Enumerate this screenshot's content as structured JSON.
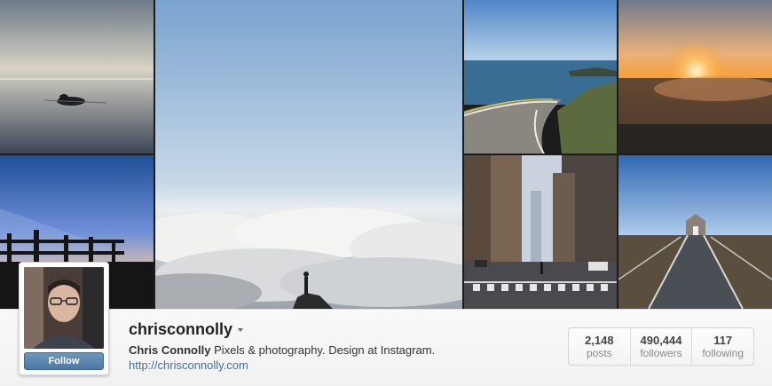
{
  "profile": {
    "username": "chrisconnolly",
    "full_name": "Chris Connolly",
    "bio": "Pixels & photography. Design at Instagram.",
    "website": "http://chrisconnolly.com",
    "follow_label": "Follow"
  },
  "stats": [
    {
      "value": "2,148",
      "label": "posts"
    },
    {
      "value": "490,444",
      "label": "followers"
    },
    {
      "value": "117",
      "label": "following"
    }
  ],
  "photos": [
    {
      "subject": "calm water with driftwood at dusk"
    },
    {
      "subject": "fence silhouette under blue sunset sky"
    },
    {
      "subject": "person standing on rock above sea of clouds"
    },
    {
      "subject": "coastal highway curving above ocean"
    },
    {
      "subject": "sunset over misty field"
    },
    {
      "subject": "city street with tall buildings and crosswalk"
    },
    {
      "subject": "wooden boardwalk leading to small house"
    }
  ],
  "colors": {
    "link": "#3f729b",
    "follow_button": "#5580ab",
    "username": "#222222"
  }
}
